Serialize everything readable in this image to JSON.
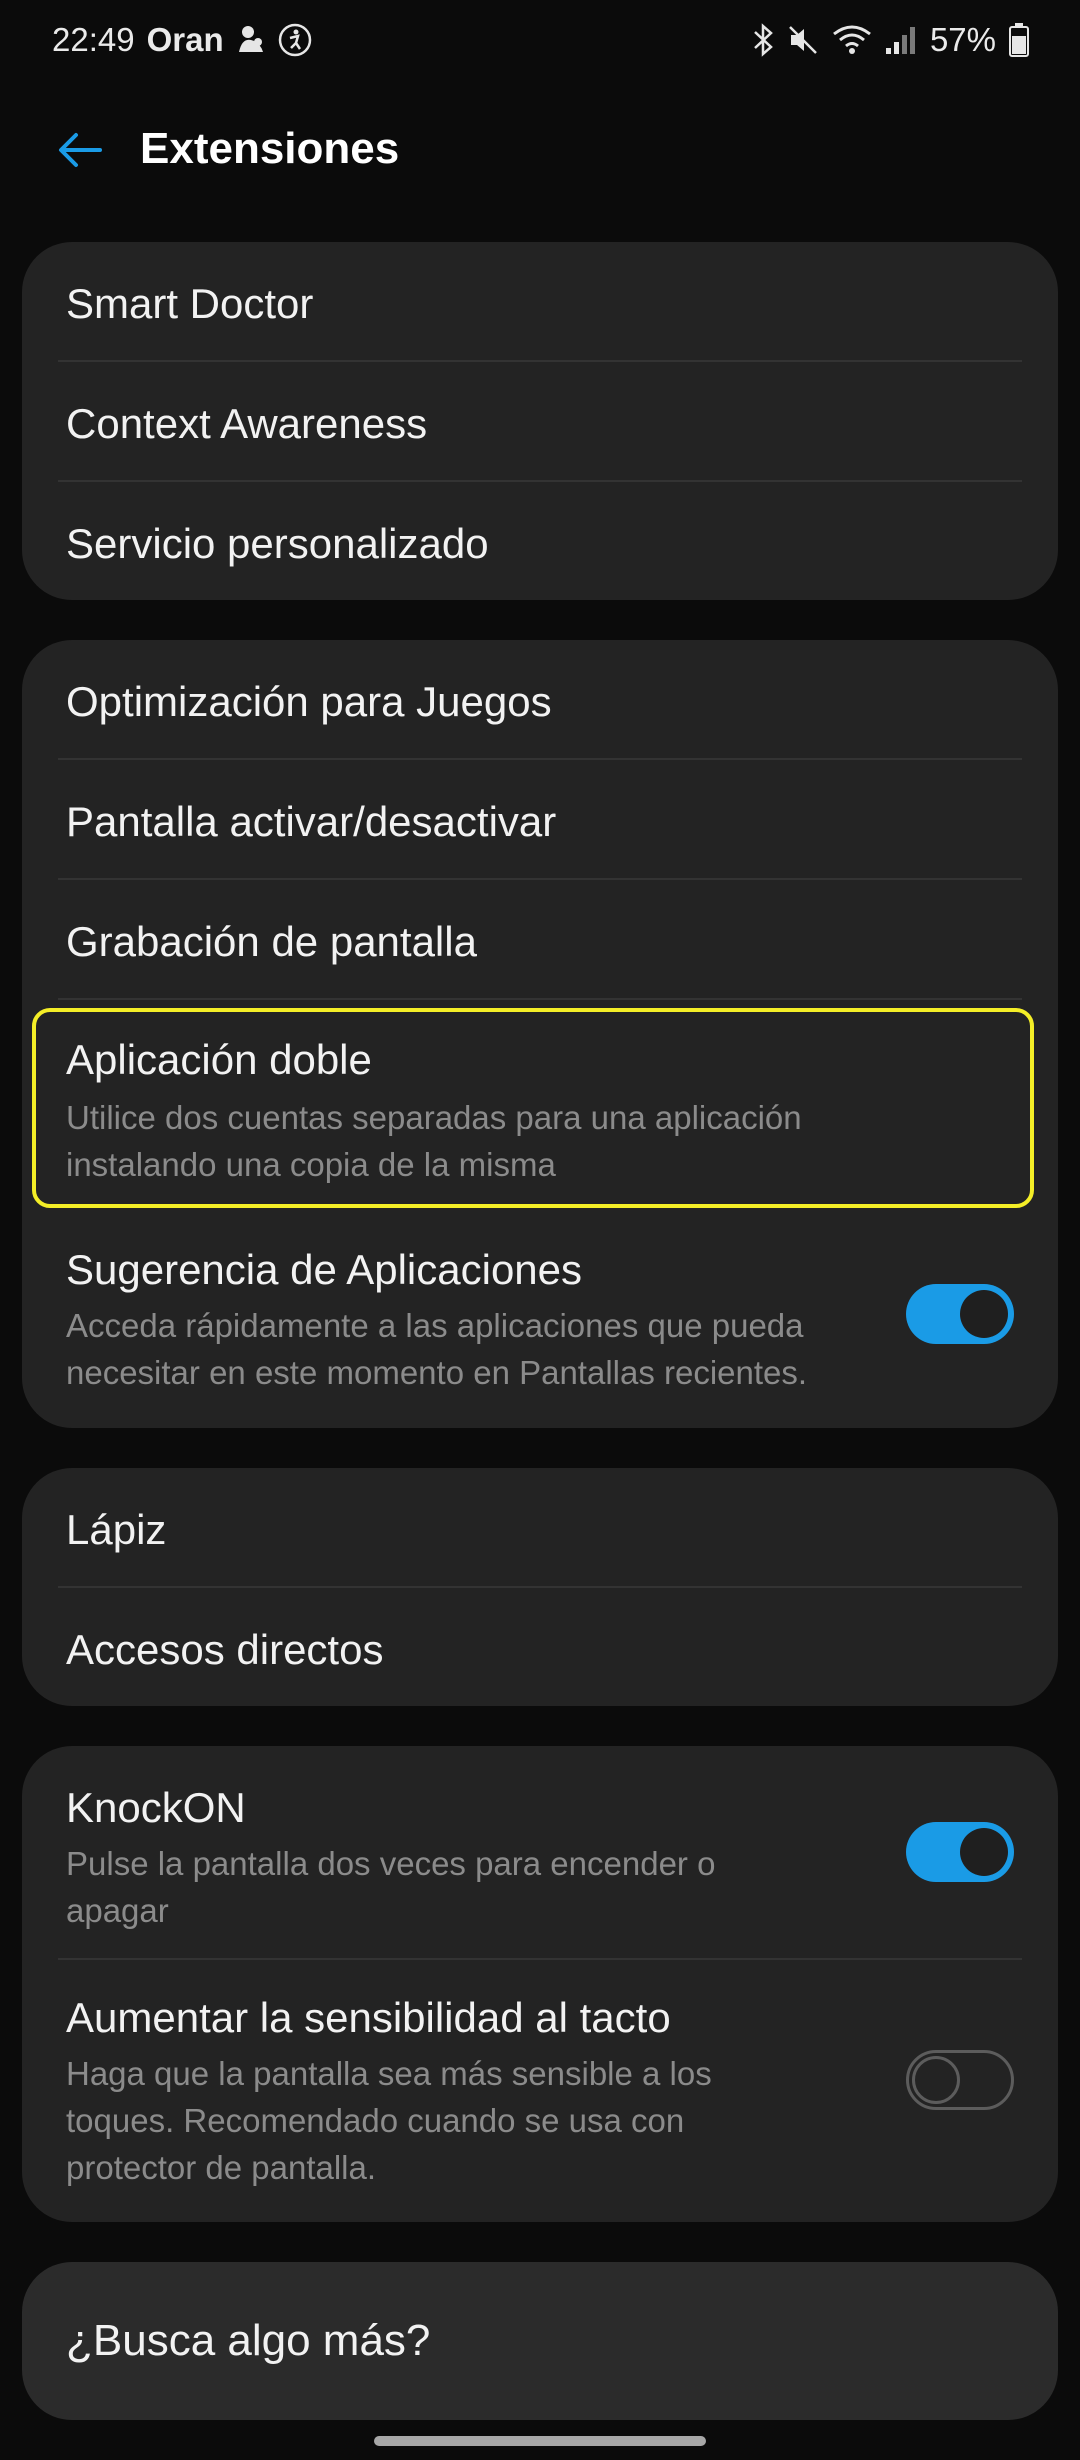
{
  "status_bar": {
    "time": "22:49",
    "carrier": "Oran",
    "battery": "57%",
    "icons_left": [
      "notification-icon",
      "accessibility-icon"
    ],
    "icons_right": [
      "bluetooth-icon",
      "mute-icon",
      "wifi-icon",
      "signal-icon",
      "battery-icon"
    ]
  },
  "app_bar": {
    "title": "Extensiones",
    "back_icon": "back-arrow-icon",
    "accent_color": "#1a9be6"
  },
  "cards": {
    "group1": [
      {
        "title": "Smart Doctor"
      },
      {
        "title": "Context Awareness"
      },
      {
        "title": "Servicio personalizado"
      }
    ],
    "group2": [
      {
        "title": "Optimización para Juegos"
      },
      {
        "title": "Pantalla activar/desactivar"
      },
      {
        "title": "Grabación de pantalla"
      },
      {
        "title": "Aplicación doble",
        "desc_line1": "Utilice dos cuentas separadas para una aplicación",
        "desc_line2": "instalando una copia de la misma"
      },
      {
        "title": "Sugerencia de Aplicaciones",
        "desc_line1": "Acceda rápidamente a las aplicaciones que pueda",
        "desc_line2": "necesitar en este momento en Pantallas recientes.",
        "toggle": true
      }
    ],
    "group3": [
      {
        "title": "Lápiz"
      },
      {
        "title": "Accesos directos"
      }
    ],
    "group4": [
      {
        "title": "KnockON",
        "desc_line1": "Pulse la pantalla dos veces para encender o",
        "desc_line2": "apagar",
        "toggle": true
      },
      {
        "title": "Aumentar la sensibilidad al tacto",
        "desc_line1": "Haga que la pantalla sea más sensible a los",
        "desc_line2": "toques. Recomendado cuando se usa con",
        "desc_line3": "protector de pantalla.",
        "toggle": false
      }
    ]
  },
  "search_more": {
    "title": "¿Busca algo más?"
  },
  "colors": {
    "background": "#0b0b0b",
    "card": "#232323",
    "highlight": "#f4ee27",
    "toggle_on": "#1a9be6"
  }
}
